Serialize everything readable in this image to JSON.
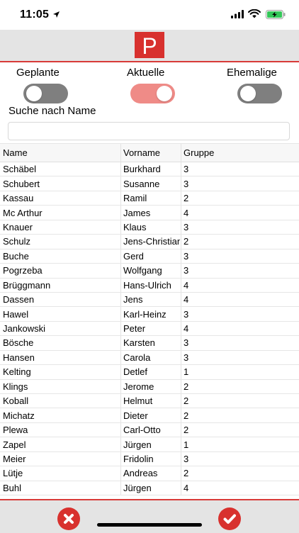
{
  "status_bar": {
    "time": "11:05"
  },
  "header": {
    "logo_letter": "P"
  },
  "filters": {
    "geplant": {
      "label": "Geplante",
      "on": false
    },
    "aktuell": {
      "label": "Aktuelle",
      "on": true
    },
    "ehemalig": {
      "label": "Ehemalige",
      "on": false
    }
  },
  "search": {
    "label": "Suche nach Name",
    "value": "",
    "placeholder": ""
  },
  "table": {
    "headers": {
      "name": "Name",
      "vorname": "Vorname",
      "gruppe": "Gruppe"
    },
    "rows": [
      {
        "name": "Schäbel",
        "vorname": "Burkhard",
        "gruppe": "3"
      },
      {
        "name": "Schubert",
        "vorname": "Susanne",
        "gruppe": "3"
      },
      {
        "name": "Kassau",
        "vorname": "Ramil",
        "gruppe": "2"
      },
      {
        "name": "Mc Arthur",
        "vorname": "James",
        "gruppe": "4"
      },
      {
        "name": "Knauer",
        "vorname": "Klaus",
        "gruppe": "3"
      },
      {
        "name": "Schulz",
        "vorname": "Jens-Christian",
        "gruppe": "2"
      },
      {
        "name": "Buche",
        "vorname": "Gerd",
        "gruppe": "3"
      },
      {
        "name": "Pogrzeba",
        "vorname": "Wolfgang",
        "gruppe": "3"
      },
      {
        "name": "Brüggmann",
        "vorname": "Hans-Ulrich",
        "gruppe": "4"
      },
      {
        "name": "Dassen",
        "vorname": "Jens",
        "gruppe": "4"
      },
      {
        "name": "Hawel",
        "vorname": "Karl-Heinz",
        "gruppe": "3"
      },
      {
        "name": "Jankowski",
        "vorname": "Peter",
        "gruppe": "4"
      },
      {
        "name": "Bösche",
        "vorname": "Karsten",
        "gruppe": "3"
      },
      {
        "name": "Hansen",
        "vorname": "Carola",
        "gruppe": "3"
      },
      {
        "name": "Kelting",
        "vorname": "Detlef",
        "gruppe": "1"
      },
      {
        "name": "Klings",
        "vorname": "Jerome",
        "gruppe": "2"
      },
      {
        "name": "Koball",
        "vorname": "Helmut",
        "gruppe": "2"
      },
      {
        "name": "Michatz",
        "vorname": "Dieter",
        "gruppe": "2"
      },
      {
        "name": "Plewa",
        "vorname": "Carl-Otto",
        "gruppe": "2"
      },
      {
        "name": "Zapel",
        "vorname": "Jürgen",
        "gruppe": "1"
      },
      {
        "name": "Meier",
        "vorname": "Fridolin",
        "gruppe": "3"
      },
      {
        "name": "Lütje",
        "vorname": "Andreas",
        "gruppe": "2"
      },
      {
        "name": "Buhl",
        "vorname": "Jürgen",
        "gruppe": "4"
      }
    ]
  },
  "footer": {
    "cancel_icon": "close-icon",
    "confirm_icon": "check-icon"
  },
  "colors": {
    "accent": "#d8312e",
    "toggle_on": "#ef8b87",
    "toggle_off": "#7f7f7f",
    "bar": "#e4e4e4"
  }
}
